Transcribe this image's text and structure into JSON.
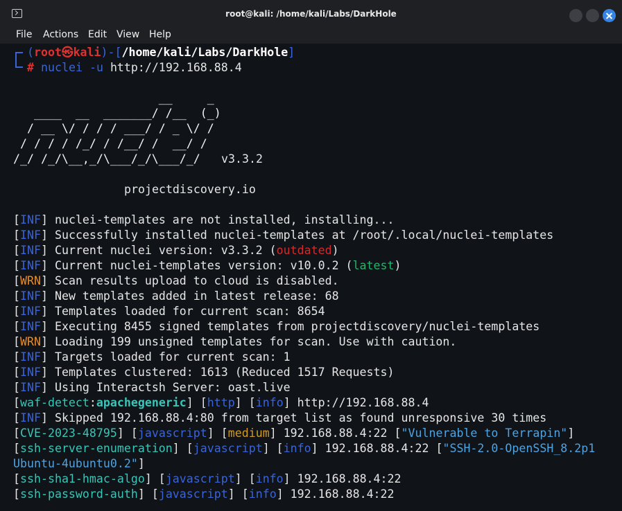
{
  "window": {
    "title": "root@kali: /home/kali/Labs/DarkHole"
  },
  "menu": {
    "file": "File",
    "actions": "Actions",
    "edit": "Edit",
    "view": "View",
    "help": "Help"
  },
  "prompt": {
    "open": "(",
    "user": "root",
    "at": "㉿",
    "host": "kali",
    "close_dash": ")-[",
    "path": "/home/kali/Labs/DarkHole",
    "close": "]",
    "hash": "#",
    "command": "nuclei",
    "flag": "-u",
    "url": "http://192.168.88.4"
  },
  "banner": {
    "art": [
      "                     __     _",
      "   ____  __  _______/ /__  (_)",
      "  / __ \\/ / / / ___/ / _ \\/ /",
      " / / / / /_/ / /__/ /  __/ /",
      "/_/ /_/\\__,_/\\___/_/\\___/_/"
    ],
    "version": "v3.3.2",
    "site": "projectdiscovery.io"
  },
  "log": {
    "inf": "INF",
    "wrn": "WRN",
    "l1": "nuclei-templates are not installed, installing...",
    "l2": "Successfully installed nuclei-templates at /root/.local/nuclei-templates",
    "l3a": "Current nuclei version: v3.3.2 (",
    "l3b": "outdated",
    "l3c": ")",
    "l4a": "Current nuclei-templates version: v10.0.2 (",
    "l4b": "latest",
    "l4c": ")",
    "l5": "Scan results upload to cloud is disabled.",
    "l6": "New templates added in latest release: 68",
    "l7": "Templates loaded for current scan: 8654",
    "l8": "Executing 8455 signed templates from projectdiscovery/nuclei-templates",
    "l9": "Loading 199 unsigned templates for scan. Use with caution.",
    "l10": "Targets loaded for current scan: 1",
    "l11": "Templates clustered: 1613 (Reduced 1517 Requests)",
    "l12": "Using Interactsh Server: oast.live",
    "l13_id": "waf-detect",
    "l13_sub": "apachegeneric",
    "l13_proto": "http",
    "l13_sev": "info",
    "l13_target": "http://192.168.88.4",
    "l14": "Skipped 192.168.88.4:80 from target list as found unresponsive 30 times",
    "l15_id": "CVE-2023-48795",
    "l15_proto": "javascript",
    "l15_sev": "medium",
    "l15_target": "192.168.88.4:22",
    "l15_extra": "\"Vulnerable to Terrapin\"",
    "l16_id": "ssh-server-enumeration",
    "l16_proto": "javascript",
    "l16_sev": "info",
    "l16_target": "192.168.88.4:22",
    "l16_extra_a": "\"SSH-2.0-OpenSSH_8.2p1",
    "l16_extra_b": "Ubuntu-4ubuntu0.2\"",
    "l17_id": "ssh-sha1-hmac-algo",
    "l17_proto": "javascript",
    "l17_sev": "info",
    "l17_target": "192.168.88.4:22",
    "l18_id": "ssh-password-auth",
    "l18_proto": "javascript",
    "l18_sev": "info",
    "l18_target": "192.168.88.4:22"
  }
}
